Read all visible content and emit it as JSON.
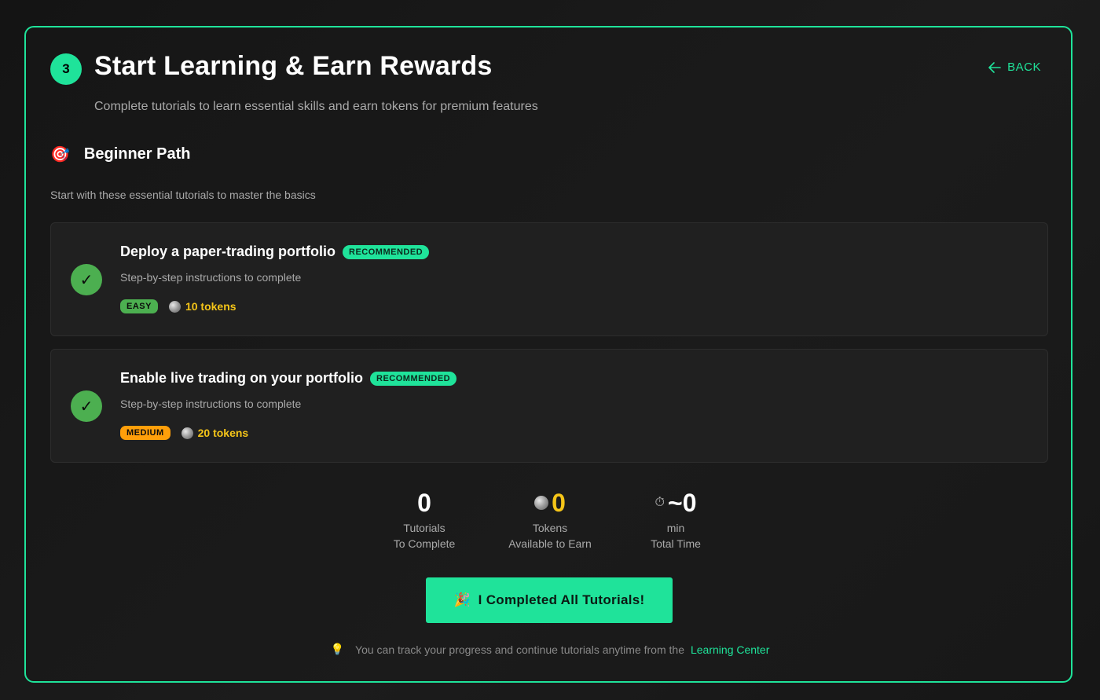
{
  "header": {
    "step_number": "3",
    "title": "Start Learning & Earn Rewards",
    "subtitle": "Complete tutorials to learn essential skills and earn tokens for premium features",
    "back_label": "BACK"
  },
  "section": {
    "icon": "target-icon",
    "title": "Beginner Path",
    "description": "Start with these essential tutorials to master the basics"
  },
  "tutorials": [
    {
      "title": "Deploy a paper-trading portfolio",
      "badge": "RECOMMENDED",
      "description": "Step-by-step instructions to complete",
      "difficulty": "EASY",
      "difficulty_color": "#4caf50",
      "tokens": "10 tokens",
      "completed": true
    },
    {
      "title": "Enable live trading on your portfolio",
      "badge": "RECOMMENDED",
      "description": "Step-by-step instructions to complete",
      "difficulty": "MEDIUM",
      "difficulty_color": "#ff9f0a",
      "tokens": "20 tokens",
      "completed": true
    }
  ],
  "stats": {
    "tutorials": {
      "value": "0",
      "label": "Tutorials",
      "sub": "To Complete"
    },
    "tokens": {
      "value": "0",
      "label": "Tokens",
      "sub": "Available to Earn"
    },
    "time": {
      "value": "~0",
      "label": "min",
      "sub": "Total Time"
    }
  },
  "cta": {
    "icon": "party-popper-icon",
    "label": "I Completed All Tutorials!"
  },
  "footer": {
    "text": "You can track your progress and continue tutorials anytime from the",
    "link": "Learning Center"
  },
  "colors": {
    "accent": "#1fe39a",
    "gold": "#f5c518",
    "success": "#4caf50",
    "warning": "#ff9f0a"
  }
}
